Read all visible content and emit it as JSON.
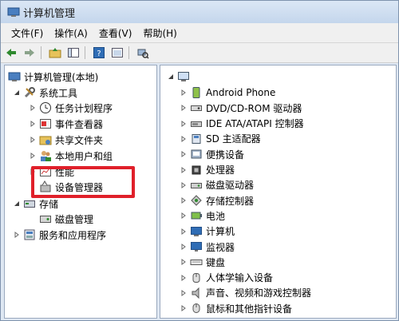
{
  "window": {
    "title": "计算机管理"
  },
  "menu": [
    "文件(F)",
    "操作(A)",
    "查看(V)",
    "帮助(H)"
  ],
  "tree": {
    "root": "计算机管理(本地)",
    "system_tools": "系统工具",
    "task_scheduler": "任务计划程序",
    "event_viewer": "事件查看器",
    "shared_folders": "共享文件夹",
    "local_users": "本地用户和组",
    "performance": "性能",
    "device_manager": "设备管理器",
    "storage": "存储",
    "disk_management": "磁盘管理",
    "services_apps": "服务和应用程序"
  },
  "devices": [
    "Android Phone",
    "DVD/CD-ROM 驱动器",
    "IDE ATA/ATAPI 控制器",
    "SD 主适配器",
    "便携设备",
    "处理器",
    "磁盘驱动器",
    "存储控制器",
    "电池",
    "计算机",
    "监视器",
    "键盘",
    "人体学输入设备",
    "声音、视频和游戏控制器",
    "鼠标和其他指针设备"
  ],
  "colors": {
    "highlight": "#e0202a",
    "accent": "#2f6db5"
  }
}
